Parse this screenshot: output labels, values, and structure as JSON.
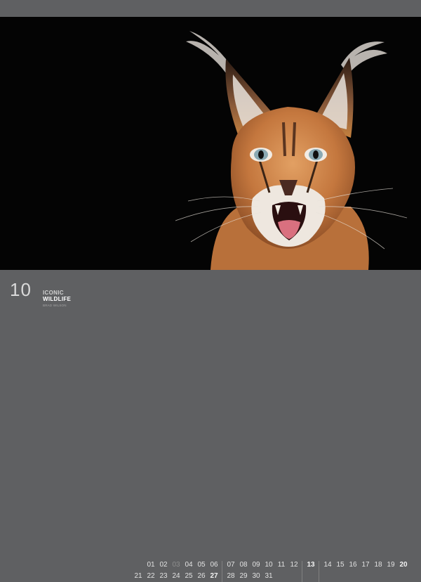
{
  "calendar": {
    "month_number": "10",
    "brand_line1": "ICONIC",
    "brand_line2": "WILDLIFE",
    "brand_line3": "BRAD WILSON"
  },
  "days_row1": [
    {
      "d": "01",
      "muted": false
    },
    {
      "d": "02",
      "muted": false
    },
    {
      "d": "03",
      "muted": true
    },
    {
      "d": "04",
      "muted": false
    },
    {
      "d": "05",
      "muted": false
    },
    {
      "d": "06",
      "muted": false
    },
    {
      "d": "07",
      "muted": false
    },
    {
      "d": "08",
      "muted": false
    },
    {
      "d": "09",
      "muted": false
    },
    {
      "d": "10",
      "muted": false
    },
    {
      "d": "11",
      "muted": false
    },
    {
      "d": "12",
      "muted": false
    },
    {
      "d": "13",
      "muted": false,
      "bold": true
    },
    {
      "d": "14",
      "muted": false
    },
    {
      "d": "15",
      "muted": false
    },
    {
      "d": "16",
      "muted": false
    },
    {
      "d": "17",
      "muted": false
    },
    {
      "d": "18",
      "muted": false
    },
    {
      "d": "19",
      "muted": false
    },
    {
      "d": "20",
      "muted": false,
      "bold": true
    }
  ],
  "days_row2": [
    {
      "d": "21",
      "muted": false
    },
    {
      "d": "22",
      "muted": false
    },
    {
      "d": "23",
      "muted": false
    },
    {
      "d": "24",
      "muted": false
    },
    {
      "d": "25",
      "muted": false
    },
    {
      "d": "26",
      "muted": false
    },
    {
      "d": "27",
      "muted": false,
      "bold": true
    },
    {
      "d": "28",
      "muted": false
    },
    {
      "d": "29",
      "muted": false
    },
    {
      "d": "30",
      "muted": false
    },
    {
      "d": "31",
      "muted": false
    }
  ],
  "colors": {
    "background": "#5f6062",
    "photo_bg": "#040404",
    "fur": "#c4773e",
    "eye": "#8aa9b3"
  },
  "icons": {
    "photo_subject": "caracal-cat-portrait"
  }
}
